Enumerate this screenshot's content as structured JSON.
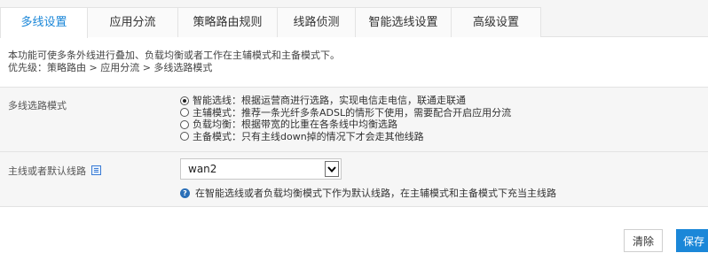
{
  "tabs": [
    {
      "label": "多线设置",
      "active": true
    },
    {
      "label": "应用分流",
      "active": false
    },
    {
      "label": "策略路由规则",
      "active": false
    },
    {
      "label": "线路侦测",
      "active": false
    },
    {
      "label": "智能选线设置",
      "active": false
    },
    {
      "label": "高级设置",
      "active": false
    }
  ],
  "description": {
    "line1": "本功能可使多条外线进行叠加、负载均衡或者工作在主辅模式和主备模式下。",
    "line2": "优先级：策略路由 > 应用分流 > 多线选路模式"
  },
  "mode": {
    "label": "多线选路模式",
    "options": [
      {
        "text": "智能选线：根据运营商进行选路，实现电信走电信，联通走联通",
        "checked": true
      },
      {
        "text": "主辅模式：推荐一条光纤多条ADSL的情形下使用，需要配合开启应用分流",
        "checked": false
      },
      {
        "text": "负载均衡：根据带宽的比重在各条线中均衡选路",
        "checked": false
      },
      {
        "text": "主备模式：只有主线down掉的情况下才会走其他线路",
        "checked": false
      }
    ]
  },
  "default_line": {
    "label": "主线或者默认线路",
    "value": "wan2",
    "hint": "在智能选线或者负载均衡模式下作为默认线路，在主辅模式和主备模式下充当主线路"
  },
  "buttons": {
    "clear": "清除",
    "save": "保存"
  },
  "colors": {
    "accent": "#1b87d8",
    "band_bg": "#f6f6f6"
  }
}
